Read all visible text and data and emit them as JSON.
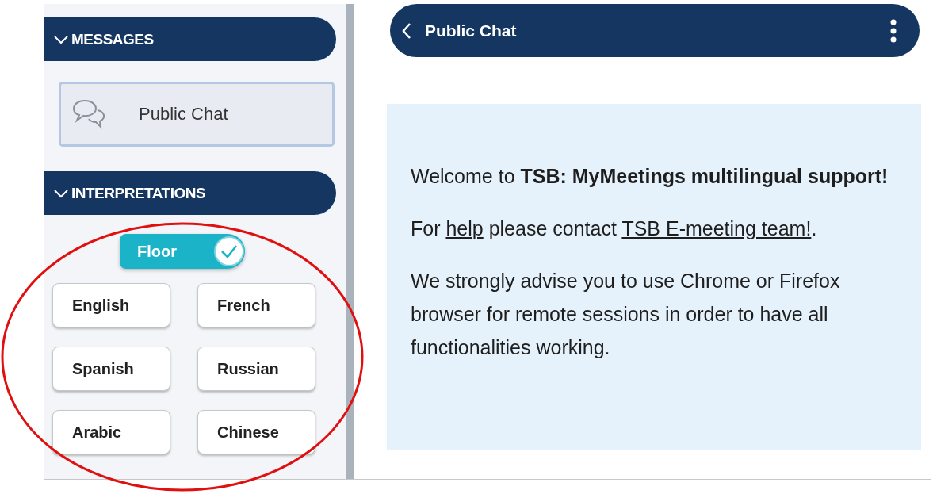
{
  "sidebar": {
    "sections": [
      {
        "kind": "messages",
        "title": "MESSAGES",
        "expanded": true,
        "items": [
          {
            "label": "Public Chat",
            "selected": true
          }
        ]
      },
      {
        "kind": "interpretations",
        "title": "INTERPRETATIONS",
        "expanded": true,
        "floor": {
          "label": "Floor",
          "on": true
        },
        "languages": [
          {
            "label": "English",
            "selected": false
          },
          {
            "label": "French",
            "selected": false
          },
          {
            "label": "Spanish",
            "selected": false
          },
          {
            "label": "Russian",
            "selected": false
          },
          {
            "label": "Arabic",
            "selected": false
          },
          {
            "label": "Chinese",
            "selected": false
          }
        ]
      }
    ]
  },
  "chat": {
    "title": "Public Chat",
    "messages": [
      {
        "kind": "rich",
        "text": "Welcome to **TSB: MyMeetings multilingual support!**"
      },
      {
        "kind": "parts",
        "parts": [
          {
            "text": "For "
          },
          {
            "text": "help",
            "kind": "link"
          },
          {
            "text": " please contact "
          },
          {
            "text": "TSB E-meeting team!",
            "kind": "link"
          },
          {
            "text": "."
          }
        ]
      },
      {
        "kind": "rich",
        "text": "We strongly advise you to use Chrome or Firefox browser for remote sessions in order to have all functionalities working."
      }
    ]
  }
}
